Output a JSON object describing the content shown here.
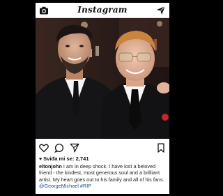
{
  "header": {
    "brand": "Instagram",
    "left_icon": "camera-icon",
    "right_icon": "send-icon"
  },
  "post": {
    "photo_icon": "photo-image",
    "actions": [
      "heart-icon",
      "comment-icon",
      "share-icon",
      "bookmark-icon"
    ],
    "likes_label": "Sviđa mi se: 2,741",
    "caption": {
      "username": "eltonjohn",
      "text": "I am in deep shock. I have lost a beloved friend - the kindest, most generous soul and a brilliant artist. My heart goes out to his family and all of his fans.",
      "hashtags": "@GeorgeMichael #RIP"
    }
  },
  "colors": {
    "background": "#000000",
    "card": "#ffffff",
    "link": "#1f4f86"
  }
}
